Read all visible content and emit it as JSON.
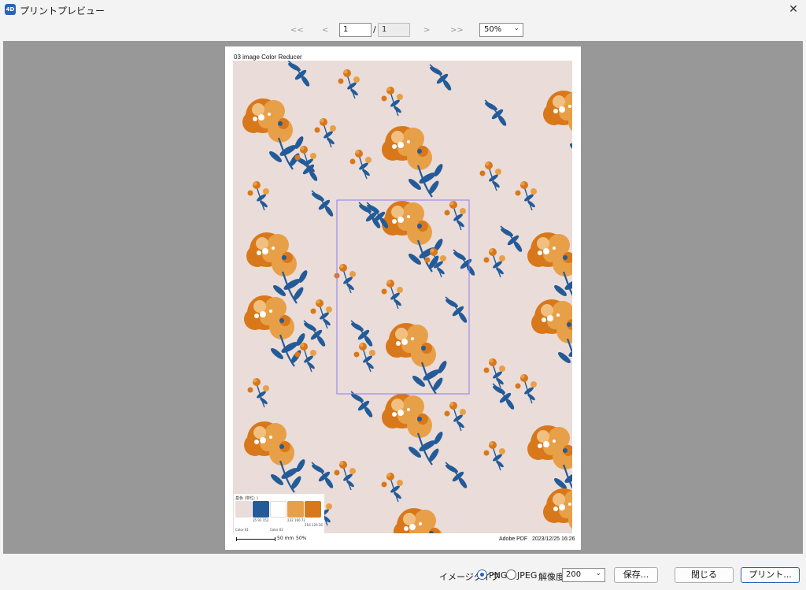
{
  "window": {
    "app_icon_text": "4D",
    "title": "プリントプレビュー",
    "close": "✕"
  },
  "nav": {
    "first": "<<",
    "prev": "<",
    "next": ">",
    "last": ">>",
    "current_page": "1",
    "slash": "/",
    "total_pages": "1",
    "zoom": "50%"
  },
  "document": {
    "title": "03 image  Color Reducer",
    "footer_left": "Adobe PDF",
    "footer_date": "2023/12/25 16:26",
    "legend_title": "基色 (単位: )",
    "scale_label": "50 mm",
    "scale_percent": "50%",
    "swatches": [
      {
        "color": "#eadcd8",
        "label": ""
      },
      {
        "color": "#235b98",
        "label": "35 91 152"
      },
      {
        "color": "#ffffff",
        "label": ""
      },
      {
        "color": "#e8a048",
        "label": "232 160 72"
      },
      {
        "color": "#d8781a",
        "label": "216 120 26"
      }
    ],
    "swatch_name_1": "Color 01",
    "swatch_name_2": "Color 02"
  },
  "colors": {
    "background": "#eadcd8",
    "petal_dark": "#d8781a",
    "petal_light": "#e8a048",
    "leaf": "#235b98",
    "selection": "#8d7cf0"
  },
  "footer": {
    "image_type_label": "イメージタイプ",
    "png": "PNG",
    "jpeg": "JPEG",
    "resolution_label": "解像度",
    "resolution": "200",
    "save": "保存...",
    "close": "閉じる",
    "print": "プリント..."
  }
}
